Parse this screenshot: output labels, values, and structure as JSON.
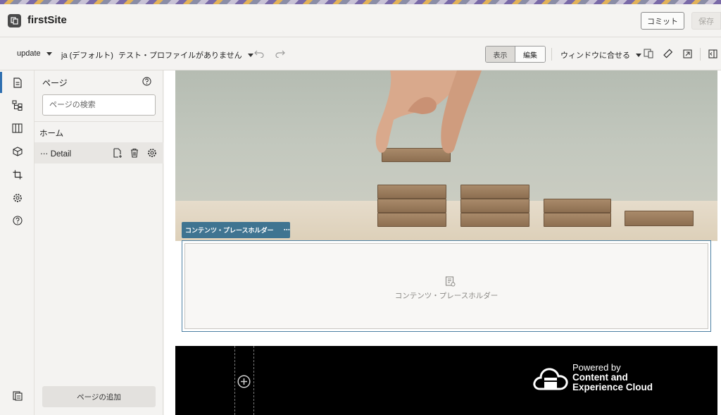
{
  "header": {
    "site_title": "firstSite",
    "commit_label": "コミット",
    "save_label": "保存"
  },
  "toolbar": {
    "update_label": "update",
    "language_label": "ja (デフォルト)",
    "profile_label": "テスト・プロファイルがありません",
    "view_label": "表示",
    "edit_label": "編集",
    "fit_label": "ウィンドウに合せる"
  },
  "sidebar": {
    "title": "ページ",
    "search_placeholder": "ページの検索",
    "home_label": "ホーム",
    "detail_label": "⋯ Detail",
    "add_page_label": "ページの追加"
  },
  "canvas": {
    "placeholder_tag": "コンテンツ・プレースホルダー",
    "placeholder_menu": "⋯",
    "placeholder_text": "コンテンツ・プレースホルダー",
    "footer_powered_by": "Powered by",
    "footer_brand_line1": "Content and",
    "footer_brand_line2": "Experience Cloud"
  },
  "colors": {
    "accent_blue": "#3f7491",
    "rail_active": "#2f6fb0",
    "background": "#f4f3f1"
  }
}
